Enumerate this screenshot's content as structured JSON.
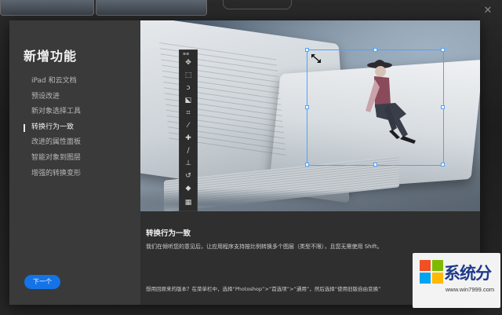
{
  "dialog": {
    "title": "新增功能",
    "nav_items": [
      {
        "label": "iPad 和云文档"
      },
      {
        "label": "预设改进"
      },
      {
        "label": "新对象选择工具"
      },
      {
        "label": "转换行为一致"
      },
      {
        "label": "改进的属性面板"
      },
      {
        "label": "智能对象到图层"
      },
      {
        "label": "增强的转换变形"
      }
    ],
    "active_index": 3,
    "next_label": "下一个",
    "accent": "#1473e6"
  },
  "content": {
    "title": "转换行为一致",
    "description": "我们在倾听您的意见后，让应用程序支持按比例转换多个图层（类型不限），且您无需使用 Shift。",
    "hint": "想用回原来的版本？在菜单栏中，选择“Photoshop”>“首选项”>“通用”，然后选择“使用旧版自由变换”"
  },
  "toolbar": {
    "tools": [
      "move-icon",
      "marquee-icon",
      "lasso-icon",
      "object-select-icon",
      "crop-icon",
      "eyedropper-icon",
      "healing-brush-icon",
      "brush-icon",
      "stamp-icon",
      "history-brush-icon",
      "eraser-icon",
      "gradient-icon"
    ]
  },
  "watermark": {
    "text": "系统分",
    "url": "www.win7999.com"
  }
}
